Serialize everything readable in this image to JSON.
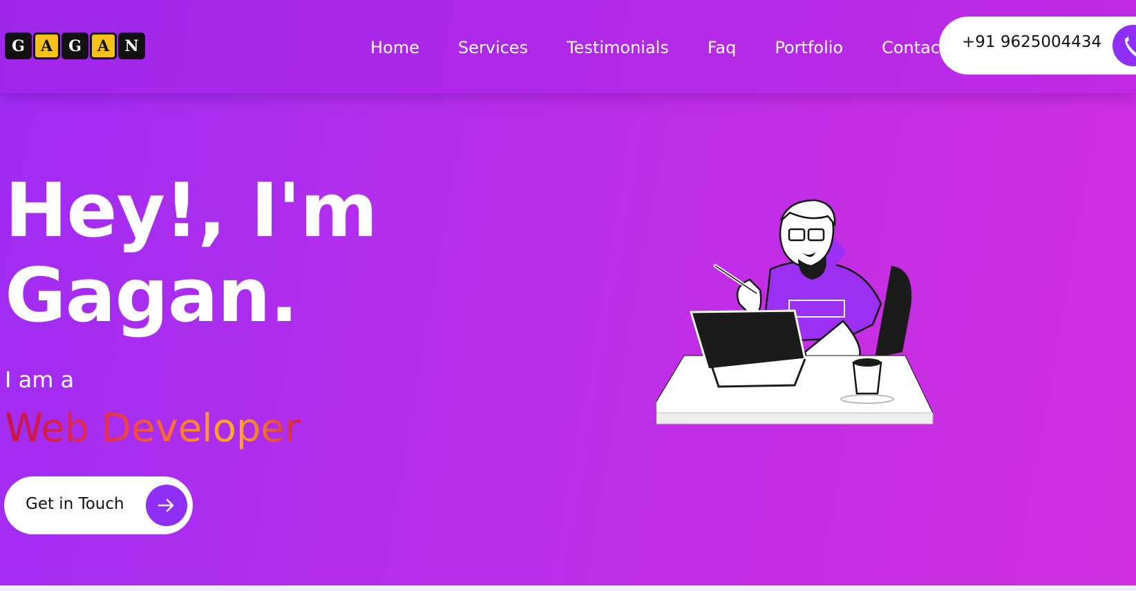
{
  "logo": {
    "letters": [
      "G",
      "A",
      "G",
      "A",
      "N"
    ]
  },
  "nav": {
    "items": [
      "Home",
      "Services",
      "Testimonials",
      "Faq",
      "Portfolio",
      "Contact"
    ]
  },
  "phone": {
    "number": "+91 9625004434",
    "icon": "phone-icon"
  },
  "hero": {
    "title_line1": "Hey!, I'm",
    "title_line2": "Gagan.",
    "intro": "I am a",
    "role": "Web Developer",
    "cta_label": "Get in Touch",
    "cta_icon": "arrow-right-icon"
  },
  "illustration": {
    "icon": "developer-at-desk-illustration"
  },
  "colors": {
    "accent": "#8f2ef5",
    "logo_yellow": "#f7c11a",
    "bg_start": "#9f2cf2",
    "bg_end": "#d12fe0"
  }
}
